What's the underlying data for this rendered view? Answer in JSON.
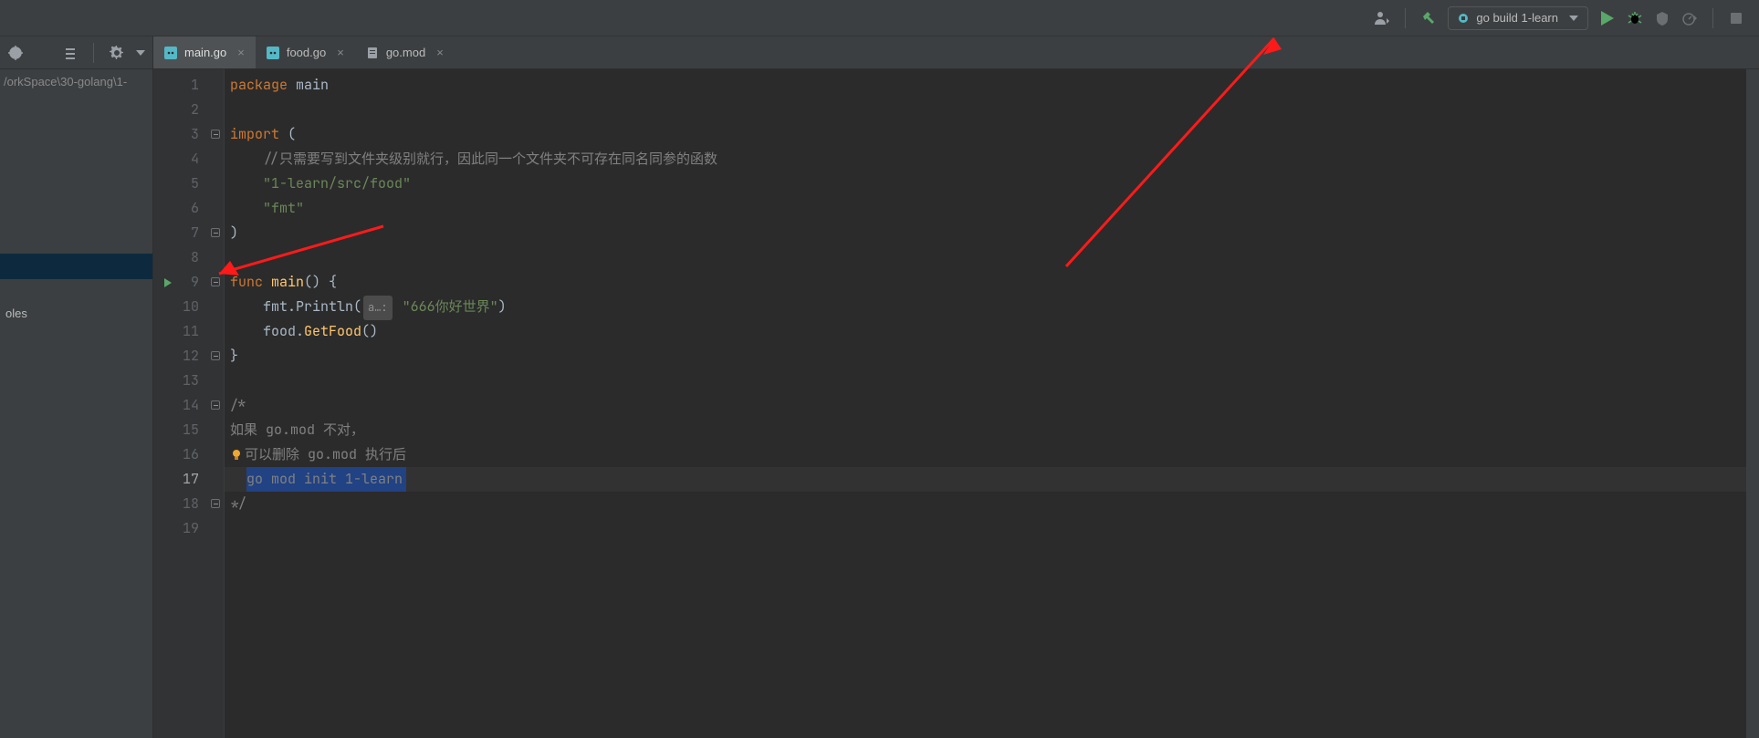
{
  "toolbar": {
    "run_config_label": "go build 1-learn"
  },
  "sidebar": {
    "path_fragment": "/orkSpace\\30-golang\\1-",
    "tree_label": "oles"
  },
  "tabs": [
    {
      "label": "main.go",
      "icon": "go",
      "active": true
    },
    {
      "label": "food.go",
      "icon": "go",
      "active": false
    },
    {
      "label": "go.mod",
      "icon": "mod",
      "active": false
    }
  ],
  "editor": {
    "current_line": 17,
    "selection": {
      "line": 17,
      "col_start": 2,
      "text": "go mod init 1-learn"
    },
    "gutter_run_line": 9,
    "lines": [
      {
        "n": 1,
        "tokens": [
          [
            "kw",
            "package "
          ],
          [
            "ident",
            "main"
          ]
        ]
      },
      {
        "n": 2,
        "tokens": []
      },
      {
        "n": 3,
        "tokens": [
          [
            "kw",
            "import "
          ],
          [
            "ident",
            "("
          ]
        ],
        "fold": true
      },
      {
        "n": 4,
        "tokens": [
          [
            "pad",
            "    "
          ],
          [
            "cmt",
            "//只需要写到文件夹级别就行，因此同一个文件夹不可存在同名同参的函数"
          ]
        ]
      },
      {
        "n": 5,
        "tokens": [
          [
            "pad",
            "    "
          ],
          [
            "str",
            "\"1-learn/src/food\""
          ]
        ]
      },
      {
        "n": 6,
        "tokens": [
          [
            "pad",
            "    "
          ],
          [
            "str",
            "\"fmt\""
          ]
        ]
      },
      {
        "n": 7,
        "tokens": [
          [
            "ident",
            ")"
          ]
        ],
        "foldend": true
      },
      {
        "n": 8,
        "tokens": []
      },
      {
        "n": 9,
        "tokens": [
          [
            "kw",
            "func "
          ],
          [
            "fn",
            "main"
          ],
          [
            "ident",
            "() {"
          ]
        ],
        "fold": true
      },
      {
        "n": 10,
        "tokens": [
          [
            "pad",
            "    "
          ],
          [
            "ident",
            "fmt.Println("
          ],
          [
            "hint",
            "a…:"
          ],
          [
            "pad",
            " "
          ],
          [
            "str",
            "\"666你好世界\""
          ],
          [
            "ident",
            ")"
          ]
        ]
      },
      {
        "n": 11,
        "tokens": [
          [
            "pad",
            "    "
          ],
          [
            "ident",
            "food."
          ],
          [
            "fn",
            "GetFood"
          ],
          [
            "ident",
            "()"
          ]
        ]
      },
      {
        "n": 12,
        "tokens": [
          [
            "ident",
            "}"
          ]
        ],
        "foldend": true
      },
      {
        "n": 13,
        "tokens": []
      },
      {
        "n": 14,
        "tokens": [
          [
            "cmt",
            "/*"
          ]
        ],
        "fold": true
      },
      {
        "n": 15,
        "tokens": [
          [
            "cmt",
            "如果 go.mod 不对，"
          ]
        ]
      },
      {
        "n": 16,
        "tokens": [
          [
            "bulb",
            ""
          ],
          [
            "cmt",
            "可以删除 go.mod 执行后"
          ]
        ]
      },
      {
        "n": 17,
        "tokens": [
          [
            "pad",
            "  "
          ],
          [
            "sel",
            "go mod init 1-learn"
          ]
        ]
      },
      {
        "n": 18,
        "tokens": [
          [
            "cmt",
            "*/"
          ]
        ],
        "foldend": true
      },
      {
        "n": 19,
        "tokens": []
      }
    ]
  }
}
